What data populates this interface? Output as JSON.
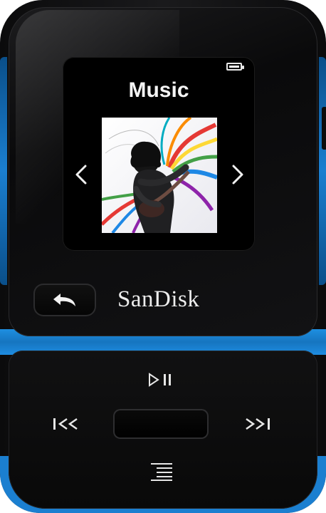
{
  "device": {
    "brand": "SanDisk",
    "accent_color": "#1b7fd0",
    "body_color": "#0b0b0c"
  },
  "screen": {
    "title": "Music",
    "battery_level": 1.0,
    "album_art": "musician-guitar-artwork",
    "left_arrow_icon": "chevron-left-icon",
    "right_arrow_icon": "chevron-right-icon"
  },
  "controls": {
    "back": "back-arrow-icon",
    "play_pause": "play-pause-icon",
    "previous": "previous-track-icon",
    "next": "next-track-icon",
    "select": "center-select-button",
    "menu": "menu-icon"
  }
}
